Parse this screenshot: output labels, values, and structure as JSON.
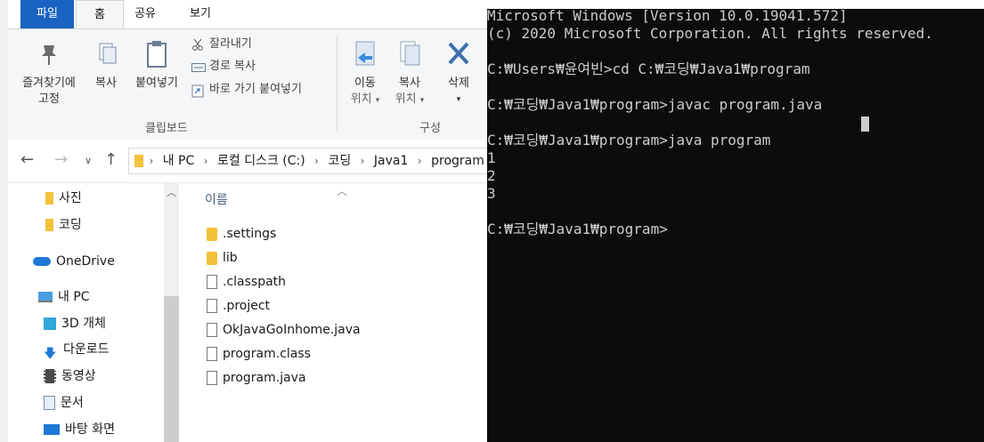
{
  "explorer": {
    "tabs": {
      "file": "파일",
      "home": "홈",
      "share": "공유",
      "view": "보기"
    },
    "ribbon": {
      "pin_label_1": "즐겨찾기에",
      "pin_label_2": "고정",
      "copy": "복사",
      "paste": "붙여넣기",
      "cut": "잘라내기",
      "copy_path": "경로 복사",
      "paste_shortcut": "바로 가기 붙여넣기",
      "clipboard_group": "클립보드",
      "move_to_1": "이동",
      "move_to_2": "위치",
      "copy_to_1": "복사",
      "copy_to_2": "위치",
      "delete": "삭제",
      "organize_group": "구성"
    },
    "address": {
      "crumbs": [
        "내 PC",
        "로컬 디스크 (C:)",
        "코딩",
        "Java1",
        "program"
      ]
    },
    "nav": {
      "items": [
        "사진",
        "코딩",
        "OneDrive",
        "내 PC",
        "3D 개체",
        "다운로드",
        "동영상",
        "문서",
        "바탕 화면"
      ]
    },
    "files": {
      "column_name": "이름",
      "rows": [
        ".settings",
        "lib",
        ".classpath",
        ".project",
        "OkJavaGoInhome.java",
        "program.class",
        "program.java"
      ]
    }
  },
  "console": {
    "lines": [
      "Microsoft Windows [Version 10.0.19041.572]",
      "(c) 2020 Microsoft Corporation. All rights reserved.",
      "",
      "C:₩Users₩윤여빈>cd C:₩코딩₩Java1₩program",
      "",
      "C:₩코딩₩Java1₩program>javac program.java",
      "",
      "C:₩코딩₩Java1₩program>java program",
      "1",
      "2",
      "3",
      "",
      "C:₩코딩₩Java1₩program>"
    ]
  },
  "colors": {
    "file_tab": "#1a63c2",
    "console_bg": "#0c0c0c",
    "console_fg": "#cccccc",
    "folder": "#f3c13a"
  }
}
